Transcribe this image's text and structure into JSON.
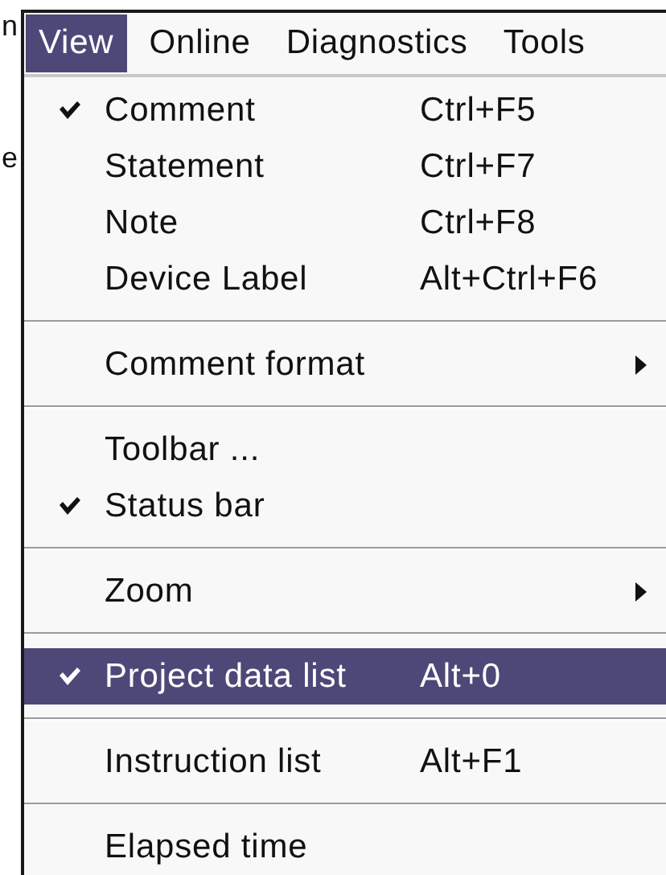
{
  "background_text": [
    "n",
    "e"
  ],
  "menu_bar": [
    {
      "label": "View",
      "selected": true
    },
    {
      "label": "Online",
      "selected": false
    },
    {
      "label": "Diagnostics",
      "selected": false
    },
    {
      "label": "Tools",
      "selected": false
    }
  ],
  "menu": [
    {
      "kind": "item",
      "label": "Comment",
      "shortcut": "Ctrl+F5",
      "checked": true,
      "selected": false
    },
    {
      "kind": "item",
      "label": "Statement",
      "shortcut": "Ctrl+F7",
      "checked": false,
      "selected": false
    },
    {
      "kind": "item",
      "label": "Note",
      "shortcut": "Ctrl+F8",
      "checked": false,
      "selected": false
    },
    {
      "kind": "item",
      "label": "Device Label",
      "shortcut": "Alt+Ctrl+F6",
      "checked": false,
      "selected": false
    },
    {
      "kind": "separator"
    },
    {
      "kind": "submenu",
      "label": "Comment format",
      "checked": false,
      "selected": false
    },
    {
      "kind": "separator"
    },
    {
      "kind": "item",
      "label": "Toolbar ...",
      "checked": false,
      "selected": false
    },
    {
      "kind": "item",
      "label": "Status bar",
      "checked": true,
      "selected": false
    },
    {
      "kind": "separator"
    },
    {
      "kind": "submenu",
      "label": "Zoom",
      "checked": false,
      "selected": false
    },
    {
      "kind": "separator"
    },
    {
      "kind": "item",
      "label": "Project data list",
      "shortcut": "Alt+0",
      "checked": true,
      "selected": true
    },
    {
      "kind": "separator"
    },
    {
      "kind": "item",
      "label": "Instruction list",
      "shortcut": "Alt+F1",
      "checked": false,
      "selected": false
    },
    {
      "kind": "separator"
    },
    {
      "kind": "item",
      "label": "Elapsed time",
      "checked": false,
      "selected": false
    }
  ]
}
